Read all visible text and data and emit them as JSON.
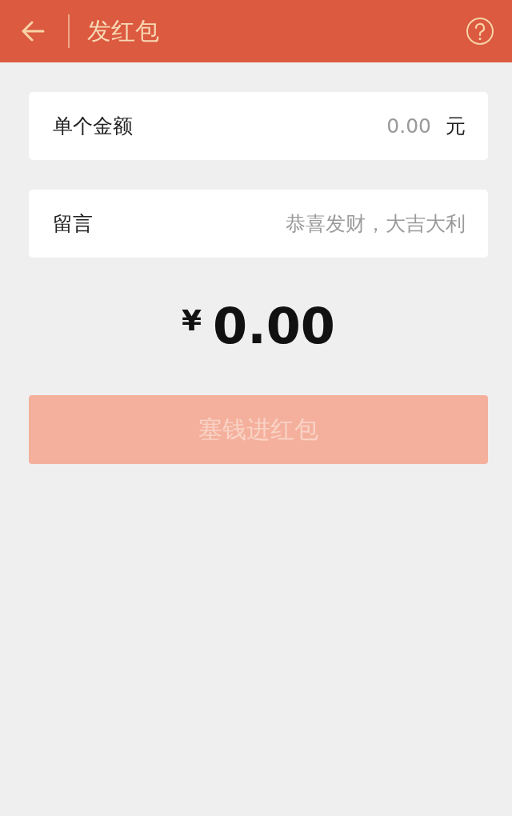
{
  "header": {
    "title": "发红包"
  },
  "fields": [
    {
      "kind": "amount",
      "label": "单个金额",
      "placeholder": "0.00",
      "unit": "元"
    },
    {
      "kind": "message",
      "label": "留言",
      "placeholder": "恭喜发财，大吉大利"
    }
  ],
  "total": {
    "currency": "¥",
    "amount": "0.00"
  },
  "submit": {
    "label": "塞钱进红包",
    "disabled": true
  }
}
